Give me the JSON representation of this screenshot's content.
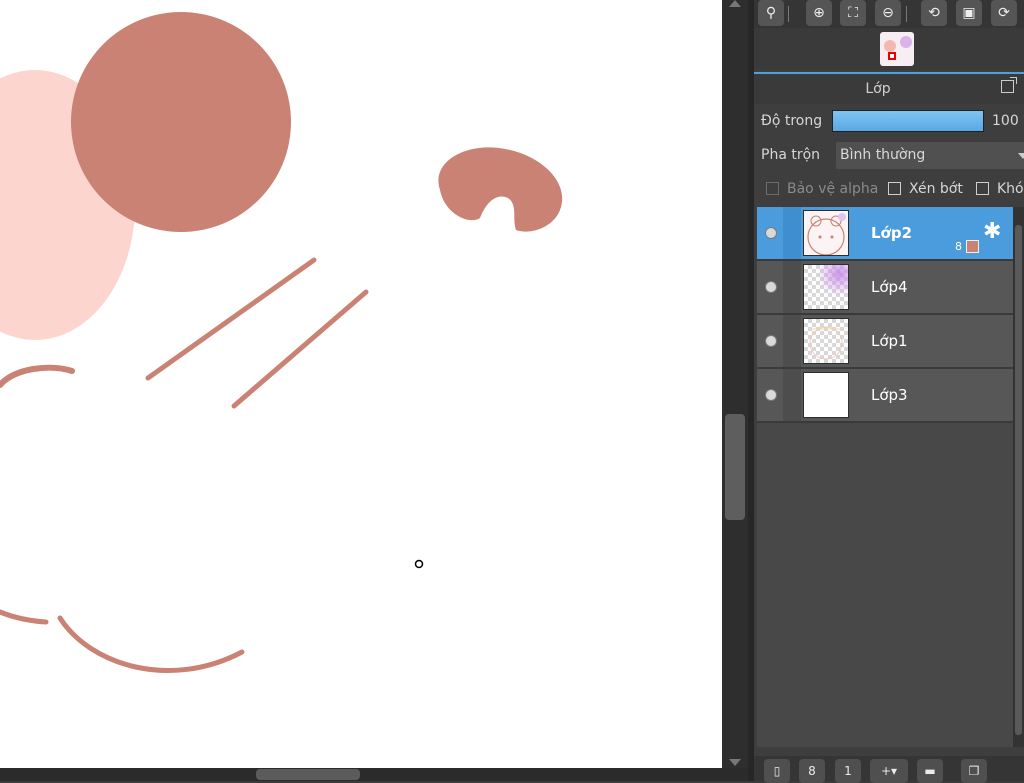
{
  "canvas": {
    "art_color": "#c98273",
    "pink_color": "#fdd5cf",
    "background": "#ffffff"
  },
  "navigator": {
    "buttons": [
      {
        "name": "zoom-fit-icon",
        "glyph": "🔍"
      },
      {
        "name": "zoom-in-icon",
        "glyph": "⊕"
      },
      {
        "name": "fit-window-icon",
        "glyph": "⛶"
      },
      {
        "name": "zoom-out-icon",
        "glyph": "⊖"
      },
      {
        "name": "rotate-left-icon",
        "glyph": "⟲"
      },
      {
        "name": "fullscreen-icon",
        "glyph": "▣"
      },
      {
        "name": "rotate-right-icon",
        "glyph": "⟳"
      }
    ]
  },
  "layer_panel": {
    "title": "Lớp",
    "opacity_label": "Độ trong",
    "opacity_value": "100 %",
    "opacity_percent": 100,
    "blend_label": "Pha trộn",
    "blend_value": "Bình thường",
    "checkboxes": {
      "protect_alpha": "Bảo vệ alpha",
      "clipping": "Xén bớt",
      "lock": "Khóa"
    },
    "layers": [
      {
        "name": "Lớp2",
        "selected": true,
        "count": "8",
        "color": "#c98273",
        "thumb": "sketch"
      },
      {
        "name": "Lớp4",
        "selected": false,
        "thumb": "purple"
      },
      {
        "name": "Lớp1",
        "selected": false,
        "thumb": "faint"
      },
      {
        "name": "Lớp3",
        "selected": false,
        "thumb": "white"
      }
    ]
  },
  "bottom_toolbar": {
    "buttons": [
      {
        "name": "new-layer-icon",
        "glyph": "▯"
      },
      {
        "name": "new-8bit-layer-icon",
        "glyph": "8"
      },
      {
        "name": "new-1bit-layer-icon",
        "glyph": "1"
      },
      {
        "name": "add-layer-menu-icon",
        "glyph": "+▾"
      },
      {
        "name": "new-folder-icon",
        "glyph": "▬"
      },
      {
        "name": "duplicate-layer-icon",
        "glyph": "❐"
      }
    ]
  },
  "accent_color": "#4a9cdc"
}
